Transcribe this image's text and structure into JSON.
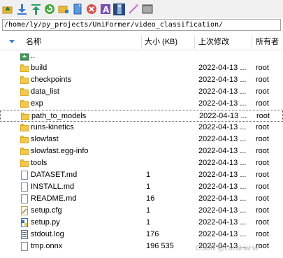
{
  "toolbar": {
    "icons": [
      "go-parent-icon",
      "download-icon",
      "upload-icon",
      "refresh-icon",
      "new-folder-icon",
      "new-file-icon",
      "delete-icon",
      "rename-icon",
      "properties-icon",
      "edit-icon",
      "terminal-icon"
    ]
  },
  "path": "/home/ly/py_projects/UniFormer/video_classification/",
  "columns": {
    "name": "名称",
    "size": "大小 (KB)",
    "modified": "上次修改",
    "owner": "所有者"
  },
  "rows": [
    {
      "name": "..",
      "size": "",
      "modified": "",
      "owner": "",
      "type": "parent"
    },
    {
      "name": "build",
      "size": "",
      "modified": "2022-04-13 ...",
      "owner": "root",
      "type": "folder"
    },
    {
      "name": "checkpoints",
      "size": "",
      "modified": "2022-04-13 ...",
      "owner": "root",
      "type": "folder"
    },
    {
      "name": "data_list",
      "size": "",
      "modified": "2022-04-13 ...",
      "owner": "root",
      "type": "folder"
    },
    {
      "name": "exp",
      "size": "",
      "modified": "2022-04-13 ...",
      "owner": "root",
      "type": "folder"
    },
    {
      "name": "path_to_models",
      "size": "",
      "modified": "2022-04-13 ...",
      "owner": "root",
      "type": "folder"
    },
    {
      "name": "runs-kinetics",
      "size": "",
      "modified": "2022-04-13 ...",
      "owner": "root",
      "type": "folder"
    },
    {
      "name": "slowfast",
      "size": "",
      "modified": "2022-04-13 ...",
      "owner": "root",
      "type": "folder"
    },
    {
      "name": "slowfast.egg-info",
      "size": "",
      "modified": "2022-04-13 ...",
      "owner": "root",
      "type": "folder"
    },
    {
      "name": "tools",
      "size": "",
      "modified": "2022-04-13 ...",
      "owner": "root",
      "type": "folder"
    },
    {
      "name": "DATASET.md",
      "size": "1",
      "modified": "2022-04-13 ...",
      "owner": "root",
      "type": "md"
    },
    {
      "name": "INSTALL.md",
      "size": "1",
      "modified": "2022-04-13 ...",
      "owner": "root",
      "type": "md"
    },
    {
      "name": "README.md",
      "size": "16",
      "modified": "2022-04-13 ...",
      "owner": "root",
      "type": "md"
    },
    {
      "name": "setup.cfg",
      "size": "1",
      "modified": "2022-04-13 ...",
      "owner": "root",
      "type": "cfg"
    },
    {
      "name": "setup.py",
      "size": "1",
      "modified": "2022-04-13 ...",
      "owner": "root",
      "type": "py"
    },
    {
      "name": "stdout.log",
      "size": "176",
      "modified": "2022-04-13 ...",
      "owner": "root",
      "type": "log"
    },
    {
      "name": "tmp.onnx",
      "size": "196 535",
      "modified": "2022-04-13 ...",
      "owner": "root",
      "type": "onnx"
    }
  ],
  "focused_row": 5,
  "watermark": "CSDN @LaLaHaHa"
}
